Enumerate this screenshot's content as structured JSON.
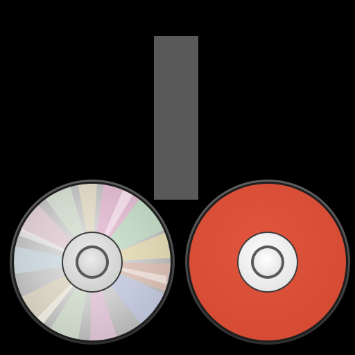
{
  "background_color": "#000000",
  "bar": {
    "color": "#595959"
  },
  "disc_left": {
    "kind": "cd-disc-icon",
    "surface": "silver-iridescent",
    "hub_color": "#dddfdd"
  },
  "disc_right": {
    "kind": "disc-with-label-icon",
    "label_color": "#dd5038",
    "hub_color": "#f2f2f2"
  }
}
